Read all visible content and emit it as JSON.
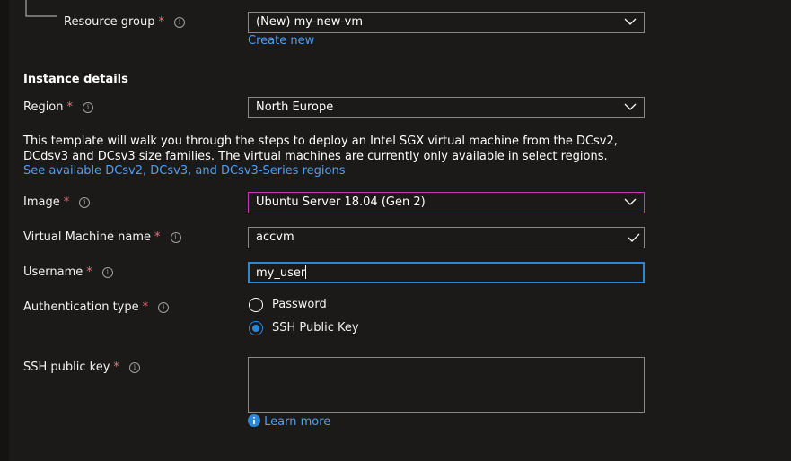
{
  "resource_group": {
    "label": "Resource group",
    "value": "(New) my-new-vm",
    "create_new": "Create new"
  },
  "instance_details": {
    "heading": "Instance details"
  },
  "region": {
    "label": "Region",
    "value": "North Europe"
  },
  "description": {
    "text": "This template will walk you through the steps to deploy an Intel SGX virtual machine from the DCsv2, DCdsv3 and DCsv3 size families. The virtual machines are currently only available in select regions.",
    "link": "See available DCsv2, DCsv3, and DCsv3-Series regions"
  },
  "image": {
    "label": "Image",
    "value": "Ubuntu Server 18.04 (Gen 2)"
  },
  "vm_name": {
    "label": "Virtual Machine name",
    "value": "accvm"
  },
  "username": {
    "label": "Username",
    "value": "my_user"
  },
  "auth_type": {
    "label": "Authentication type",
    "options": [
      "Password",
      "SSH Public Key"
    ],
    "selected": "SSH Public Key"
  },
  "ssh_key": {
    "label": "SSH public key",
    "value": "",
    "learn_more": "Learn more"
  },
  "required_marker": "*",
  "info_glyph": "i",
  "colors": {
    "background": "#1b1a19",
    "link": "#4f9ff5",
    "required": "#f1707b",
    "accent": "#2b88d8",
    "image_border": "#c239b3"
  }
}
